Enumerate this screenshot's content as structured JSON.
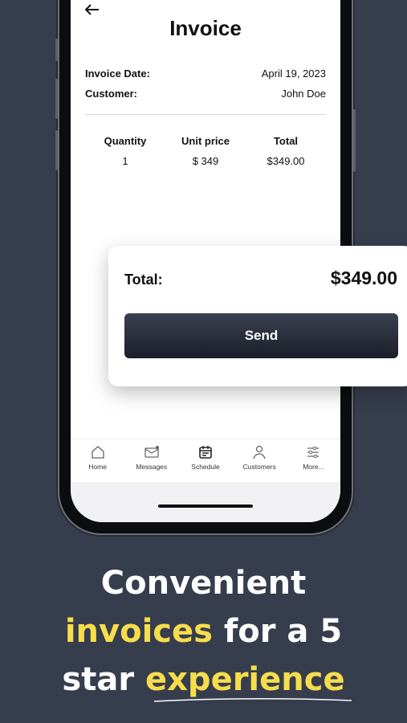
{
  "screen": {
    "title": "Invoice",
    "back_icon": "arrow-left-icon",
    "invoice_date": {
      "label": "Invoice Date:",
      "value": "April 19, 2023"
    },
    "customer": {
      "label": "Customer:",
      "value": "John Doe"
    },
    "table": {
      "headers": [
        "Quantity",
        "Unit price",
        "Total"
      ],
      "rows": [
        {
          "quantity": "1",
          "unit_price": "$ 349",
          "total": "$349.00"
        }
      ]
    },
    "tabs": [
      {
        "label": "Home",
        "icon": "home-icon"
      },
      {
        "label": "Messages",
        "icon": "mail-icon"
      },
      {
        "label": "Schedule",
        "icon": "calendar-icon"
      },
      {
        "label": "Customers",
        "icon": "person-icon"
      },
      {
        "label": "More...",
        "icon": "sliders-icon"
      }
    ]
  },
  "card": {
    "total_label": "Total:",
    "total_value": "$349.00",
    "send_label": "Send"
  },
  "headline": {
    "line1": "Convenient",
    "line2_highlight": "invoices",
    "line2_rest": " for a 5",
    "line3_start": "star ",
    "line3_highlight": "experience"
  },
  "colors": {
    "background": "#363d4d",
    "highlight": "#f7dd4b",
    "button": "#1f2430"
  }
}
